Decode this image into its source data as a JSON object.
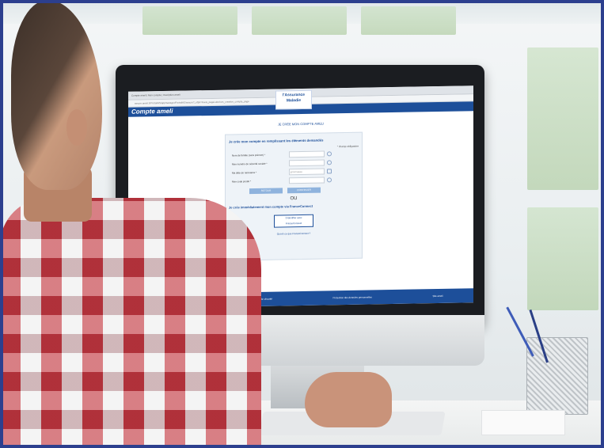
{
  "browser": {
    "tabs_text": "Compte ameli | Mon compte | Inscription ameli",
    "address": "assure.ameli.fr/PortailAS/appmanager/PortailAS/assure?_nfpb=true&_pageLabel=as_creation_compte_page"
  },
  "site": {
    "header_title": "Compte ameli",
    "logo_line1": "l'Assurance",
    "logo_line2": "Maladie",
    "page_heading": "JE CRÉE MON COMPTE AMELI"
  },
  "form": {
    "intro": "Je crée mon compte en remplissant les éléments demandés",
    "required_note": "* champ obligatoire",
    "fields": [
      {
        "label": "Nom de famille (sans prénom) *",
        "value": ""
      },
      {
        "label": "Mon numéro de sécurité sociale *",
        "value": ""
      },
      {
        "label": "Ma date de naissance *",
        "value": "jj/mm/aaaa"
      },
      {
        "label": "Mon code postal *",
        "value": ""
      }
    ],
    "back_button": "RETOUR",
    "continue_button": "CONTINUER",
    "separator": "OU",
    "franceconnect_heading": "Je crée immédiatement mon compte via FranceConnect",
    "franceconnect_button_line1": "S'identifier avec",
    "franceconnect_button_line2": "FranceConnect",
    "franceconnect_link": "Qu'est-ce que FranceConnect ?"
  },
  "footer": {
    "links": [
      "Aide et Accessibilité",
      "Recommandations de sécurité",
      "Protection des données personnelles",
      "Site ameli"
    ]
  }
}
